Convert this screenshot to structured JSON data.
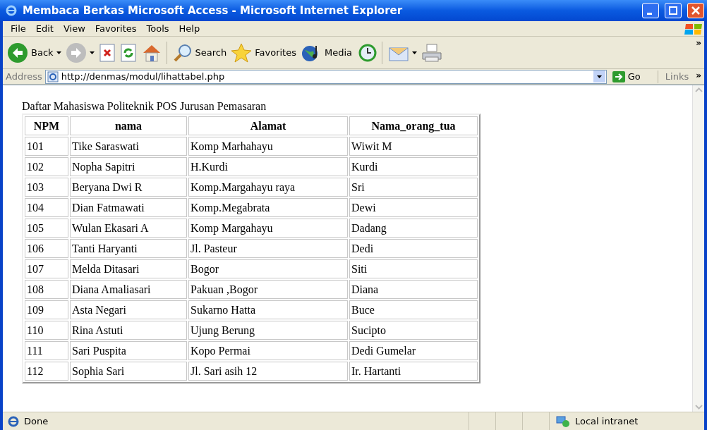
{
  "window": {
    "title": "Membaca Berkas Microsoft Access - Microsoft Internet Explorer"
  },
  "menu": [
    "File",
    "Edit",
    "View",
    "Favorites",
    "Tools",
    "Help"
  ],
  "toolbar": [
    {
      "kind": "back",
      "label": "Back",
      "disabled": false
    },
    {
      "kind": "forward",
      "disabled": true
    },
    {
      "kind": "stop"
    },
    {
      "kind": "refresh"
    },
    {
      "kind": "home"
    },
    {
      "kind": "search",
      "label": "Search"
    },
    {
      "kind": "favorites",
      "label": "Favorites"
    },
    {
      "kind": "media",
      "label": "Media"
    },
    {
      "kind": "history"
    },
    {
      "kind": "mail"
    },
    {
      "kind": "print"
    }
  ],
  "toolbar_chevron": "»",
  "address": {
    "label": "Address",
    "value": "http://denmas/modul/lihattabel.php",
    "go": "Go",
    "links": "Links",
    "links_chevron": "»"
  },
  "page": {
    "heading": "Daftar Mahasiswa Politeknik POS Jurusan Pemasaran",
    "columns": [
      "NPM",
      "nama",
      "Alamat",
      "Nama_orang_tua"
    ],
    "rows": [
      [
        "101",
        "Tike Saraswati",
        "Komp Marhahayu",
        "Wiwit M"
      ],
      [
        "102",
        "Nopha Sapitri",
        "H.Kurdi",
        "Kurdi"
      ],
      [
        "103",
        "Beryana Dwi R",
        "Komp.Margahayu raya",
        "Sri"
      ],
      [
        "104",
        "Dian Fatmawati",
        "Komp.Megabrata",
        "Dewi"
      ],
      [
        "105",
        "Wulan Ekasari A",
        "Komp Margahayu",
        "Dadang"
      ],
      [
        "106",
        "Tanti Haryanti",
        "Jl. Pasteur",
        "Dedi"
      ],
      [
        "107",
        "Melda Ditasari",
        "Bogor",
        "Siti"
      ],
      [
        "108",
        "Diana Amaliasari",
        "Pakuan ,Bogor",
        "Diana"
      ],
      [
        "109",
        "Asta Negari",
        "Sukarno Hatta",
        "Buce"
      ],
      [
        "110",
        "Rina Astuti",
        "Ujung Berung",
        "Sucipto"
      ],
      [
        "111",
        "Sari Puspita",
        "Kopo Permai",
        "Dedi Gumelar"
      ],
      [
        "112",
        "Sophia Sari",
        "Jl. Sari asih 12",
        "Ir. Hartanti"
      ]
    ]
  },
  "status_bar": {
    "text": "Done",
    "zone": "Local intranet"
  }
}
